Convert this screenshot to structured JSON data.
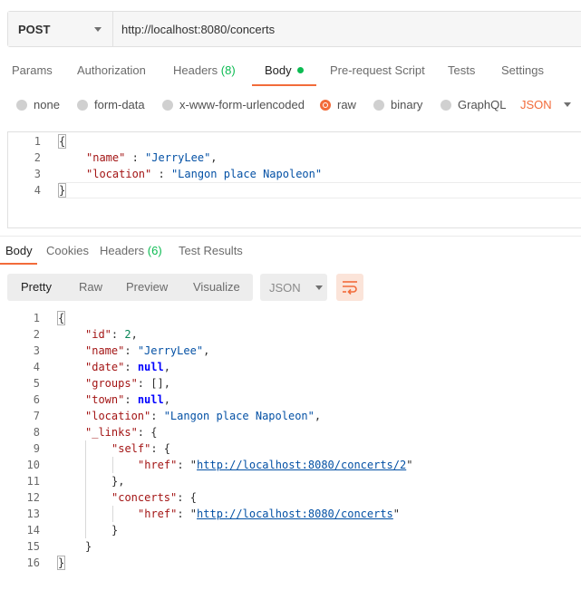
{
  "request": {
    "method": "POST",
    "url": "http://localhost:8080/concerts"
  },
  "request_tabs": [
    {
      "label": "Params"
    },
    {
      "label": "Authorization"
    },
    {
      "label": "Headers",
      "count": "(8)"
    },
    {
      "label": "Body"
    },
    {
      "label": "Pre-request Script"
    },
    {
      "label": "Tests"
    },
    {
      "label": "Settings"
    }
  ],
  "body_types": [
    {
      "label": "none"
    },
    {
      "label": "form-data"
    },
    {
      "label": "x-www-form-urlencoded"
    },
    {
      "label": "raw"
    },
    {
      "label": "binary"
    },
    {
      "label": "GraphQL"
    }
  ],
  "body_language": "JSON",
  "request_body": {
    "line_numbers": [
      "1",
      "2",
      "3",
      "4"
    ],
    "open": "{",
    "name_key": "\"name\"",
    "name_sep": " : ",
    "name_val": "\"JerryLee\"",
    "name_comma": ",",
    "location_key": "\"location\"",
    "location_sep": " : ",
    "location_val": "\"Langon place Napoleon\"",
    "close": "}"
  },
  "response_tabs": [
    {
      "label": "Body"
    },
    {
      "label": "Cookies"
    },
    {
      "label": "Headers",
      "count": "(6)"
    },
    {
      "label": "Test Results"
    }
  ],
  "view_modes": [
    {
      "label": "Pretty"
    },
    {
      "label": "Raw"
    },
    {
      "label": "Preview"
    },
    {
      "label": "Visualize"
    }
  ],
  "response_format": "JSON",
  "response_body": {
    "line_numbers": [
      "1",
      "2",
      "3",
      "4",
      "5",
      "6",
      "7",
      "8",
      "9",
      "10",
      "11",
      "12",
      "13",
      "14",
      "15",
      "16"
    ],
    "l1": "{",
    "id_key": "\"id\"",
    "id_val": "2",
    "name_key": "\"name\"",
    "name_val": "\"JerryLee\"",
    "date_key": "\"date\"",
    "date_val": "null",
    "groups_key": "\"groups\"",
    "groups_val": "[]",
    "town_key": "\"town\"",
    "town_val": "null",
    "location_key": "\"location\"",
    "location_val": "\"Langon place Napoleon\"",
    "links_key": "\"_links\"",
    "self_key": "\"self\"",
    "href_key": "\"href\"",
    "self_href": "http://localhost:8080/concerts/2",
    "concerts_key": "\"concerts\"",
    "concerts_href": "http://localhost:8080/concerts",
    "close": "}",
    "close_comma": "},"
  }
}
